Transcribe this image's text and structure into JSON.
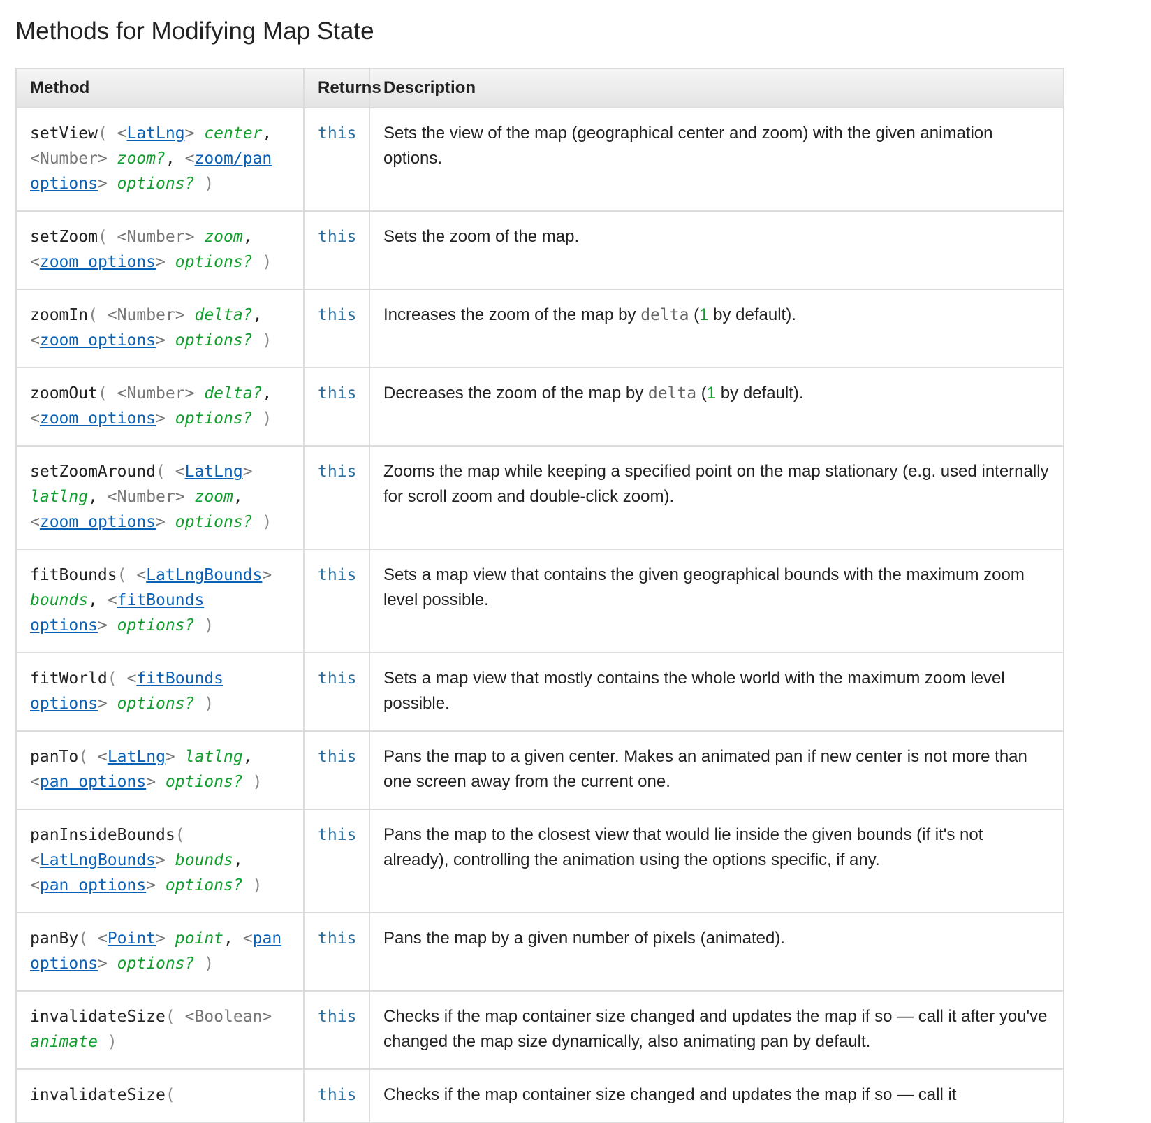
{
  "page": {
    "title": "Methods for Modifying Map State"
  },
  "table": {
    "headers": {
      "method": "Method",
      "returns": "Returns",
      "description": "Description"
    },
    "rows": [
      {
        "name": "setView",
        "params": [
          {
            "type": "LatLng",
            "type_link": true,
            "name": "center"
          },
          {
            "type": "Number",
            "type_link": false,
            "name": "zoom?"
          },
          {
            "type": "zoom/pan options",
            "type_link": true,
            "name": "options?"
          }
        ],
        "returns": "this",
        "description": [
          {
            "t": "text",
            "v": "Sets the view of the map (geographical center and zoom) with the given animation options."
          }
        ]
      },
      {
        "name": "setZoom",
        "params": [
          {
            "type": "Number",
            "type_link": false,
            "name": "zoom"
          },
          {
            "type": "zoom options",
            "type_link": true,
            "name": "options?"
          }
        ],
        "returns": "this",
        "description": [
          {
            "t": "text",
            "v": "Sets the zoom of the map."
          }
        ]
      },
      {
        "name": "zoomIn",
        "params": [
          {
            "type": "Number",
            "type_link": false,
            "name": "delta?"
          },
          {
            "type": "zoom options",
            "type_link": true,
            "name": "options?"
          }
        ],
        "returns": "this",
        "description": [
          {
            "t": "text",
            "v": "Increases the zoom of the map by "
          },
          {
            "t": "code",
            "v": "delta"
          },
          {
            "t": "text",
            "v": " ("
          },
          {
            "t": "num",
            "v": "1"
          },
          {
            "t": "text",
            "v": " by default)."
          }
        ]
      },
      {
        "name": "zoomOut",
        "params": [
          {
            "type": "Number",
            "type_link": false,
            "name": "delta?"
          },
          {
            "type": "zoom options",
            "type_link": true,
            "name": "options?"
          }
        ],
        "returns": "this",
        "description": [
          {
            "t": "text",
            "v": "Decreases the zoom of the map by "
          },
          {
            "t": "code",
            "v": "delta"
          },
          {
            "t": "text",
            "v": " ("
          },
          {
            "t": "num",
            "v": "1"
          },
          {
            "t": "text",
            "v": " by default)."
          }
        ]
      },
      {
        "name": "setZoomAround",
        "params": [
          {
            "type": "LatLng",
            "type_link": true,
            "name": "latlng"
          },
          {
            "type": "Number",
            "type_link": false,
            "name": "zoom"
          },
          {
            "type": "zoom options",
            "type_link": true,
            "name": "options?"
          }
        ],
        "returns": "this",
        "description": [
          {
            "t": "text",
            "v": "Zooms the map while keeping a specified point on the map stationary (e.g. used internally for scroll zoom and double-click zoom)."
          }
        ]
      },
      {
        "name": "fitBounds",
        "params": [
          {
            "type": "LatLngBounds",
            "type_link": true,
            "name": "bounds"
          },
          {
            "type": "fitBounds options",
            "type_link": true,
            "name": "options?"
          }
        ],
        "returns": "this",
        "description": [
          {
            "t": "text",
            "v": "Sets a map view that contains the given geographical bounds with the maximum zoom level possible."
          }
        ]
      },
      {
        "name": "fitWorld",
        "params": [
          {
            "type": "fitBounds options",
            "type_link": true,
            "name": "options?"
          }
        ],
        "returns": "this",
        "description": [
          {
            "t": "text",
            "v": "Sets a map view that mostly contains the whole world with the maximum zoom level possible."
          }
        ]
      },
      {
        "name": "panTo",
        "params": [
          {
            "type": "LatLng",
            "type_link": true,
            "name": "latlng"
          },
          {
            "type": "pan options",
            "type_link": true,
            "name": "options?"
          }
        ],
        "returns": "this",
        "description": [
          {
            "t": "text",
            "v": "Pans the map to a given center. Makes an animated pan if new center is not more than one screen away from the current one."
          }
        ]
      },
      {
        "name": "panInsideBounds",
        "params": [
          {
            "type": "LatLngBounds",
            "type_link": true,
            "name": "bounds"
          },
          {
            "type": "pan options",
            "type_link": true,
            "name": "options?"
          }
        ],
        "returns": "this",
        "description": [
          {
            "t": "text",
            "v": "Pans the map to the closest view that would lie inside the given bounds (if it's not already), controlling the animation using the options specific, if any."
          }
        ]
      },
      {
        "name": "panBy",
        "params": [
          {
            "type": "Point",
            "type_link": true,
            "name": "point"
          },
          {
            "type": "pan options",
            "type_link": true,
            "name": "options?"
          }
        ],
        "returns": "this",
        "description": [
          {
            "t": "text",
            "v": "Pans the map by a given number of pixels (animated)."
          }
        ]
      },
      {
        "name": "invalidateSize",
        "params": [
          {
            "type": "Boolean",
            "type_link": false,
            "name": "animate"
          }
        ],
        "returns": "this",
        "description": [
          {
            "t": "text",
            "v": "Checks if the map container size changed and updates the map if so — call it after you've changed the map size dynamically, also animating pan by default."
          }
        ]
      },
      {
        "name": "invalidateSize",
        "params": [],
        "returns": "this",
        "description": [
          {
            "t": "text",
            "v": "Checks if the map container size changed and updates the map if so — call it"
          }
        ]
      }
    ]
  }
}
